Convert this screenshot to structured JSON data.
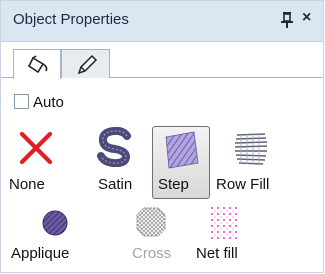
{
  "panel": {
    "title": "Object Properties",
    "pin_icon": "pin-icon",
    "close_glyph": "×"
  },
  "tabs": [
    {
      "icon": "fill-bucket-icon",
      "active": true
    },
    {
      "icon": "pencil-icon",
      "active": false
    }
  ],
  "auto": {
    "label": "Auto",
    "checked": false
  },
  "tools": {
    "none": {
      "label": "None",
      "icon": "none-x-icon",
      "enabled": true
    },
    "satin": {
      "label": "Satin",
      "icon": "satin-s-icon",
      "enabled": true
    },
    "step": {
      "label": "Step",
      "icon": "step-fill-icon",
      "enabled": true,
      "selected": true
    },
    "row_fill": {
      "label": "Row Fill",
      "icon": "row-fill-icon",
      "enabled": true
    },
    "applique": {
      "label": "Applique",
      "icon": "applique-icon",
      "enabled": true
    },
    "cross": {
      "label": "Cross",
      "icon": "cross-stitch-icon",
      "enabled": false
    },
    "net_fill": {
      "label": "Net fill",
      "icon": "net-fill-icon",
      "enabled": true
    }
  },
  "colors": {
    "titlebar": "#dce6f3",
    "none_red": "#e02020",
    "satin_purple": "#4b4a78",
    "step_purple": "#7f67b8",
    "net_magenta": "#e040c0"
  }
}
